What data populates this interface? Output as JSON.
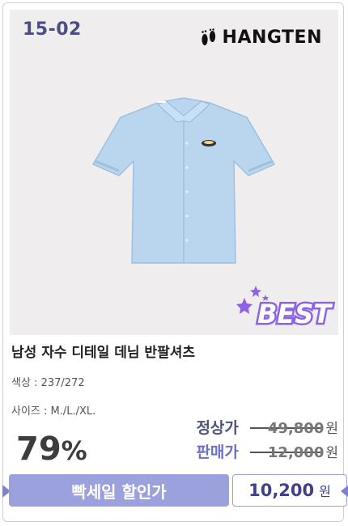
{
  "product": {
    "code": "15-02",
    "brand": "HANGTEN",
    "brand_icon": "footprints-icon",
    "badge": "BEST",
    "title": "남성 자수 디테일 데님 반팔셔츠",
    "color_label": "색상 : ",
    "color_value": "237/272",
    "size_label": "사이즈 : ",
    "size_value": "M./L./XL.",
    "discount_value": "79",
    "discount_unit": "%",
    "regular_price_label": "정상가",
    "regular_price": "49,800",
    "sale_price_label": "판매가",
    "sale_price": "12,000",
    "currency": "원",
    "sale_button_label": "빡세일 할인가",
    "final_price": "10,200",
    "final_currency": "원"
  },
  "colors": {
    "code": "#4a4d86",
    "accent": "#9ba1dd",
    "shirt": "#b9d6ee",
    "badge": "#8d63e6"
  }
}
